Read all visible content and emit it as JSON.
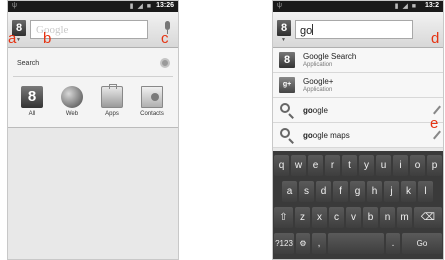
{
  "left_phone": {
    "status": {
      "signal": "ψ",
      "icons": "▮ ◢ ■",
      "time": "13:26"
    },
    "search": {
      "placeholder": "Google"
    },
    "callouts": [
      "a",
      "b",
      "c"
    ],
    "panel": {
      "title": "Search",
      "sources": [
        {
          "label": "All",
          "icon": "google-g-icon",
          "glyph": "8"
        },
        {
          "label": "Web",
          "icon": "globe-icon"
        },
        {
          "label": "Apps",
          "icon": "apps-briefcase-icon"
        },
        {
          "label": "Contacts",
          "icon": "contacts-card-icon"
        }
      ]
    }
  },
  "right_phone": {
    "status": {
      "signal": "ψ",
      "icons": "▮ ◢ ■",
      "time": "13:2"
    },
    "search": {
      "value": "go"
    },
    "callouts": [
      "d",
      "e"
    ],
    "suggestions": [
      {
        "title": "Google Search",
        "subtitle": "Application",
        "glyph": "8"
      },
      {
        "title": "Google+",
        "subtitle": "Application",
        "glyph": "g+"
      },
      {
        "query_bold": "go",
        "query_rest": "ogle"
      },
      {
        "query_bold": "go",
        "query_rest": "ogle maps"
      }
    ],
    "keyboard": {
      "row1": [
        "q",
        "w",
        "e",
        "r",
        "t",
        "y",
        "u",
        "i",
        "o",
        "p"
      ],
      "row2": [
        "a",
        "s",
        "d",
        "f",
        "g",
        "h",
        "j",
        "k",
        "l"
      ],
      "row3": [
        "⇧",
        "z",
        "x",
        "c",
        "v",
        "b",
        "n",
        "m",
        "⌫"
      ],
      "row4": [
        "?123",
        "⚙",
        ",",
        "",
        ".",
        " Go"
      ]
    }
  },
  "colors": {
    "callout": "#e63312",
    "keyboard": "#3a3a3a"
  }
}
